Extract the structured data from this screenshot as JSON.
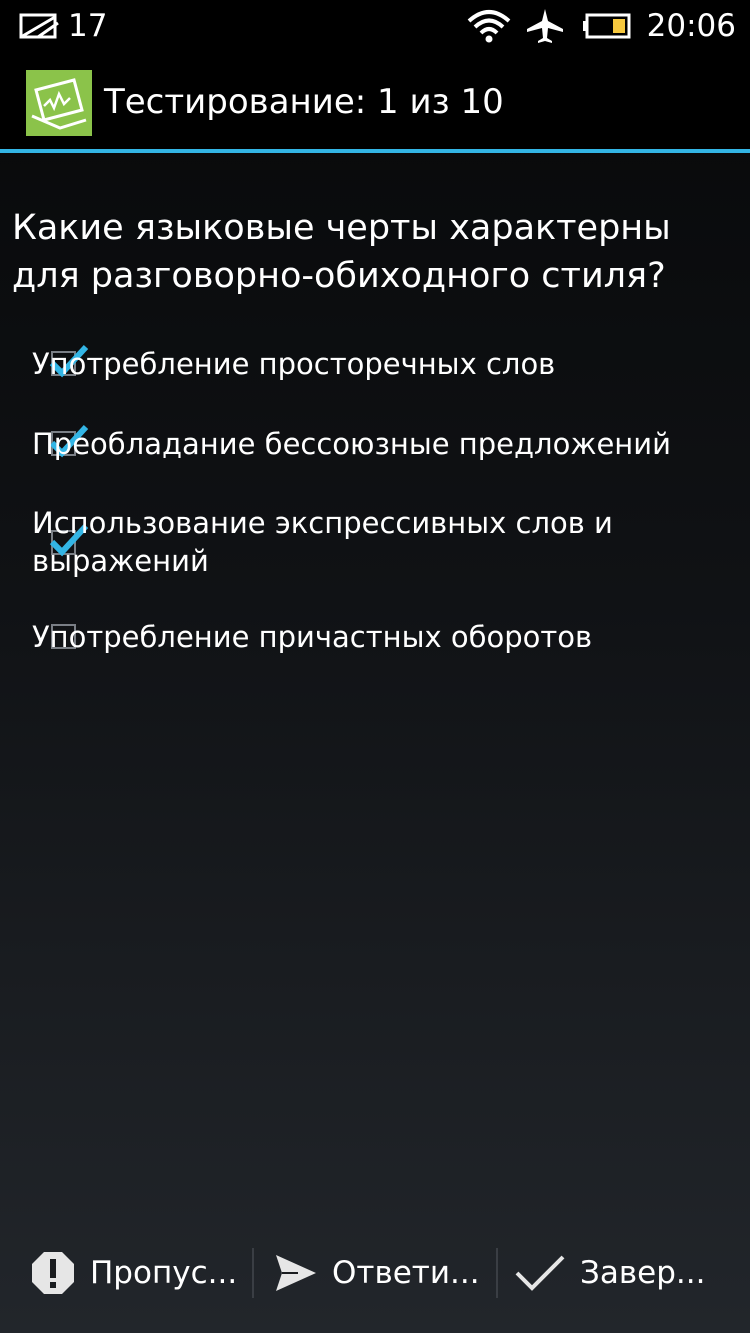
{
  "status_bar": {
    "notification_count": "17",
    "time": "20:06",
    "icons": [
      "envelope-icon",
      "wifi-icon",
      "airplane-icon",
      "battery-icon"
    ]
  },
  "action_bar": {
    "title": "Тестирование: 1 из 10",
    "icon": "app-logo-icon",
    "accent_color": "#33b5e5",
    "logo_color": "#8bc34a"
  },
  "question": {
    "text": "Какие языковые черты характерны для разговорно-обиходного стиля?"
  },
  "options": [
    {
      "label": "Употребление просторечных слов",
      "checked": true
    },
    {
      "label": "Преобладание бессоюзные предложений",
      "checked": true
    },
    {
      "label": "Использование экспрессивных слов и выражений",
      "checked": true
    },
    {
      "label": "Употребление причастных оборотов",
      "checked": false
    }
  ],
  "bottom_bar": {
    "skip_label": "Пропус...",
    "answer_label": "Ответи...",
    "finish_label": "Завер...",
    "icons": [
      "exclamation-icon",
      "send-icon",
      "checkmark-icon"
    ]
  }
}
